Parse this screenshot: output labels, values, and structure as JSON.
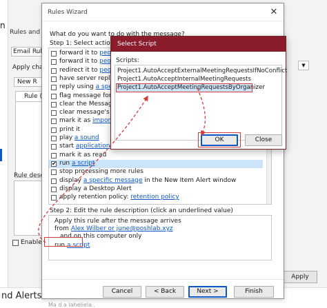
{
  "background": {
    "title_fragment": "Rules and A",
    "email_rules_tab": "Email Rule",
    "apply_changes": "Apply cha",
    "new_rule": "New R",
    "rule_column": "Rule (",
    "rule_description": "Rule desc",
    "enable": "Enable",
    "apply_button": "Apply",
    "bottom_title": "nd Alerts",
    "bottom_faint": "Ma d a laheliela .",
    "left_fragment": "n"
  },
  "wizard": {
    "title": "Rules Wizard",
    "question": "What do you want to do with the message?",
    "step1": "Step 1: Select action(s)",
    "actions": [
      {
        "text": "forward it to ",
        "link": "peo",
        "checked": false
      },
      {
        "text": "forward it to ",
        "link": "peo",
        "checked": false
      },
      {
        "text": "redirect it to ",
        "link": "peo",
        "checked": false
      },
      {
        "text": "have server reply ",
        "link": "",
        "checked": false
      },
      {
        "text": "reply using ",
        "link": "a spe",
        "checked": false
      },
      {
        "text": "flag message for ",
        "link": "",
        "checked": false
      },
      {
        "text": "clear the Message",
        "link": "",
        "checked": false
      },
      {
        "text": "clear message's C",
        "link": "",
        "checked": false
      },
      {
        "text": "mark it as ",
        "link": "importa",
        "checked": false
      },
      {
        "text": "print it",
        "link": "",
        "checked": false
      },
      {
        "text": "play ",
        "link": "a sound",
        "checked": false
      },
      {
        "text": "start ",
        "link": "application",
        "checked": false
      },
      {
        "text": "mark it as read",
        "link": "",
        "checked": false
      },
      {
        "text": "run ",
        "link": "a script",
        "checked": true,
        "selected": true
      },
      {
        "text": "stop processing more rules",
        "link": "",
        "checked": false
      },
      {
        "text": "display ",
        "link": "a specific message",
        "suffix": " in the New Item Alert window",
        "checked": false
      },
      {
        "text": "display a Desktop Alert",
        "link": "",
        "checked": false
      },
      {
        "text": "apply retention policy: ",
        "link": "retention policy",
        "checked": false
      }
    ],
    "step2": "Step 2: Edit the rule description (click an underlined value)",
    "description": {
      "line1": "Apply this rule after the message arrives",
      "line2_prefix": "from ",
      "line2_link": "Alex Wilber or june@poshlab.xyz",
      "line3": "and on this computer only",
      "line4_prefix": "run ",
      "line4_link": "a script"
    },
    "buttons": {
      "cancel": "Cancel",
      "back": "< Back",
      "next": "Next >",
      "finish": "Finish"
    }
  },
  "select_script": {
    "title": "Select Script",
    "label": "Scripts:",
    "items": [
      "Project1.AutoAcceptExternalMeetingRequestsIfNoConflict",
      "Project1.AutoAcceptInternalMeetingRequests",
      "Project1.AutoAcceptMeetingRequestsByOrganizer"
    ],
    "selected_index": 2,
    "ok": "OK",
    "cancel": "Close"
  },
  "colors": {
    "accent": "#0b57c7",
    "dialog_titlebar": "#8b1c2c",
    "annotation": "#d43a3a",
    "selection": "#cce4f7"
  }
}
